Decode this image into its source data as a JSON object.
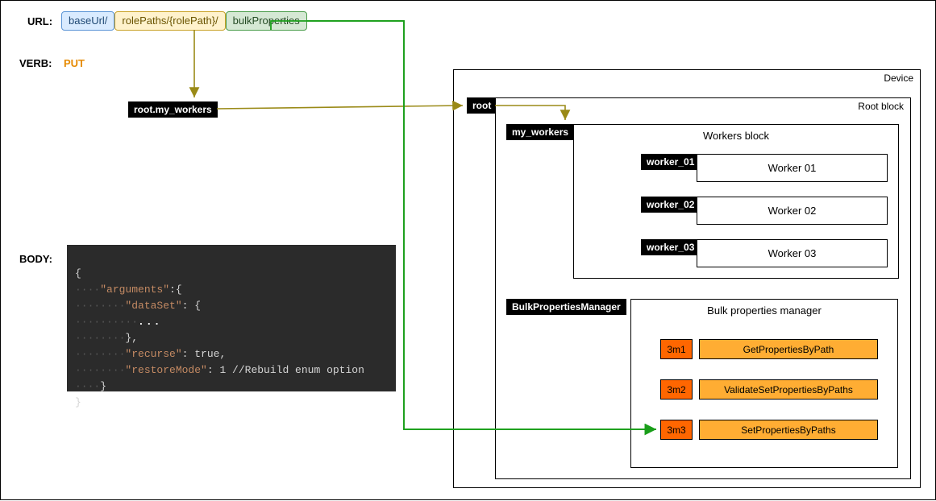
{
  "labels": {
    "url": "URL:",
    "verb": "VERB:",
    "body": "BODY:"
  },
  "verb": "PUT",
  "urlParts": {
    "base": "baseUrl/",
    "role": "rolePaths/{rolePath}/",
    "bulk": "bulkProperties"
  },
  "rolePathValue": "root.my_workers",
  "device": {
    "title": "Device",
    "root": {
      "label": "root",
      "rootBlock": {
        "title": "Root block",
        "myWorkers": {
          "label": "my_workers",
          "title": "Workers block",
          "workers": [
            {
              "tag": "worker_01",
              "title": "Worker 01"
            },
            {
              "tag": "worker_02",
              "title": "Worker 02"
            },
            {
              "tag": "worker_03",
              "title": "Worker 03"
            }
          ]
        },
        "bulkManager": {
          "label": "BulkPropertiesManager",
          "title": "Bulk properties manager",
          "methods": [
            {
              "idx": "3m1",
              "name": "GetPropertiesByPath"
            },
            {
              "idx": "3m2",
              "name": "ValidateSetPropertiesByPaths"
            },
            {
              "idx": "3m3",
              "name": "SetPropertiesByPaths"
            }
          ]
        }
      }
    }
  },
  "code": {
    "l1": "{",
    "l2a": "····",
    "l2b": "\"arguments\"",
    "l2c": ":{",
    "l3a": "········",
    "l3b": "\"dataSet\"",
    "l3c": ": {",
    "l4a": "··········",
    "l4b": "...",
    "l5a": "········",
    "l5b": "},",
    "l6a": "········",
    "l6b": "\"recurse\"",
    "l6c": ": true,",
    "l7a": "········",
    "l7b": "\"restoreMode\"",
    "l7c": ": 1 //Rebuild enum option",
    "l8a": "····",
    "l8b": "}",
    "l9": "}"
  },
  "colors": {
    "olive": "#9a8a17",
    "green": "#1a9e1a"
  }
}
